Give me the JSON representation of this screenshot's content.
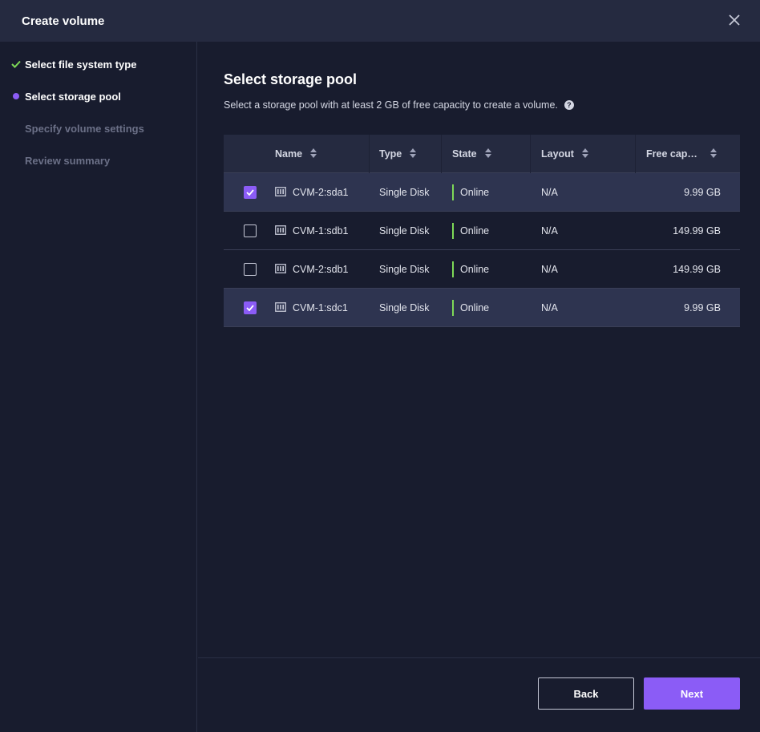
{
  "dialog": {
    "title": "Create volume",
    "close_icon": "close-icon"
  },
  "steps": [
    {
      "label": "Select file system type",
      "status": "done"
    },
    {
      "label": "Select storage pool",
      "status": "active"
    },
    {
      "label": "Specify volume settings",
      "status": "pending"
    },
    {
      "label": "Review summary",
      "status": "pending"
    }
  ],
  "main": {
    "title": "Select storage pool",
    "description": "Select a storage pool with at least 2 GB of free capacity to create a volume.",
    "help_glyph": "?"
  },
  "table": {
    "columns": [
      "Name",
      "Type",
      "State",
      "Layout",
      "Free cap…"
    ],
    "rows": [
      {
        "selected": true,
        "name": "CVM-2:sda1",
        "type": "Single Disk",
        "state": "Online",
        "layout": "N/A",
        "free": "9.99 GB"
      },
      {
        "selected": false,
        "name": "CVM-1:sdb1",
        "type": "Single Disk",
        "state": "Online",
        "layout": "N/A",
        "free": "149.99 GB"
      },
      {
        "selected": false,
        "name": "CVM-2:sdb1",
        "type": "Single Disk",
        "state": "Online",
        "layout": "N/A",
        "free": "149.99 GB"
      },
      {
        "selected": true,
        "name": "CVM-1:sdc1",
        "type": "Single Disk",
        "state": "Online",
        "layout": "N/A",
        "free": "9.99 GB"
      }
    ]
  },
  "footer": {
    "back_label": "Back",
    "next_label": "Next"
  },
  "colors": {
    "accent": "#8b5cf6",
    "done": "#7ed957",
    "online": "#7ed957"
  }
}
